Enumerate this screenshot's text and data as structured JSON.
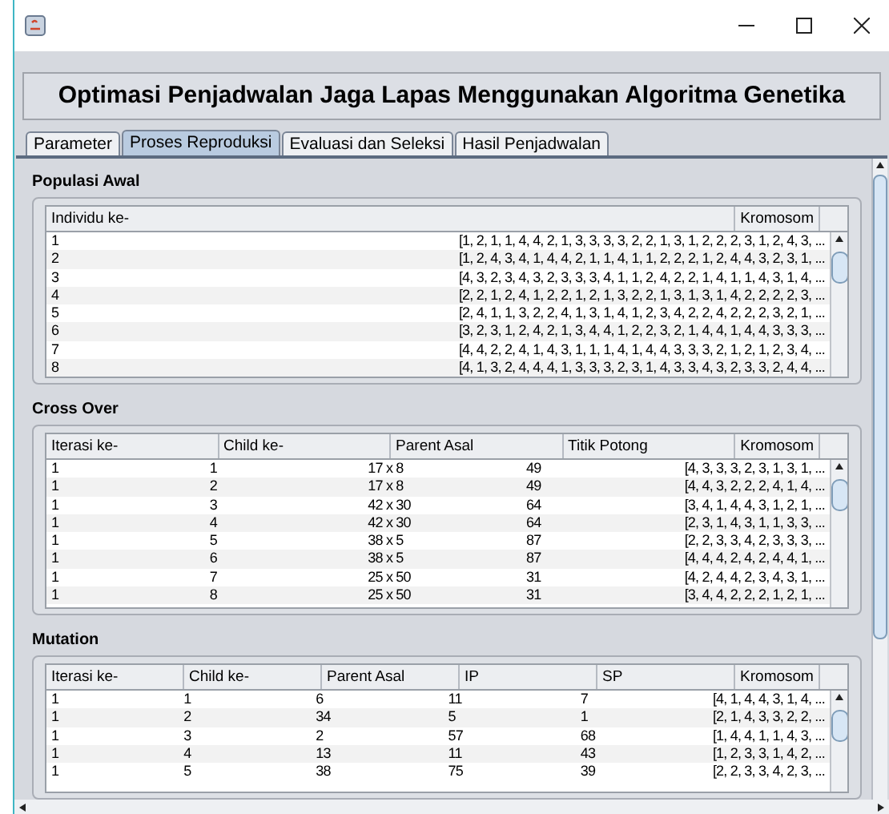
{
  "header": "Optimasi Penjadwalan Jaga Lapas Menggunakan Algoritma Genetika",
  "tabs": [
    {
      "label": "Parameter",
      "selected": false
    },
    {
      "label": "Proses Reproduksi",
      "selected": true
    },
    {
      "label": "Evaluasi dan Seleksi",
      "selected": false
    },
    {
      "label": "Hasil Penjadwalan",
      "selected": false
    }
  ],
  "sections": [
    {
      "title": "Populasi Awal",
      "columns": [
        "Individu ke-",
        "Kromosom"
      ],
      "rows": [
        [
          "1",
          "[1, 2, 1, 1, 4, 4, 2, 1, 3, 3, 3, 3, 2, 2, 1, 3, 1, 2, 2, 2, 3, 1, 2, 4, 3, ..."
        ],
        [
          "2",
          "[1, 2, 4, 3, 4, 1, 4, 4, 2, 1, 1, 4, 1, 1, 2, 2, 2, 1, 2, 4, 4, 3, 2, 3, 1, ..."
        ],
        [
          "3",
          "[4, 3, 2, 3, 4, 3, 2, 3, 3, 3, 4, 1, 1, 2, 4, 2, 2, 1, 4, 1, 1, 4, 3, 1, 4, ..."
        ],
        [
          "4",
          "[2, 2, 1, 2, 4, 1, 2, 2, 1, 2, 1, 3, 2, 2, 1, 3, 1, 3, 1, 4, 2, 2, 2, 2, 3, ..."
        ],
        [
          "5",
          "[2, 4, 1, 1, 3, 2, 2, 4, 1, 3, 1, 4, 1, 2, 3, 4, 2, 2, 4, 2, 2, 2, 3, 2, 1, ..."
        ],
        [
          "6",
          "[3, 2, 3, 1, 2, 4, 2, 1, 3, 4, 4, 1, 2, 2, 3, 2, 1, 4, 4, 1, 4, 4, 3, 3, 3, ..."
        ],
        [
          "7",
          "[4, 4, 2, 2, 4, 1, 4, 3, 1, 1, 1, 4, 1, 4, 4, 3, 3, 3, 2, 1, 2, 1, 2, 3, 4, ..."
        ],
        [
          "8",
          "[4, 1, 3, 2, 4, 4, 4, 1, 3, 3, 3, 2, 3, 1, 4, 3, 3, 4, 3, 2, 3, 3, 2, 4, 4, ..."
        ]
      ]
    },
    {
      "title": "Cross Over",
      "columns": [
        "Iterasi ke-",
        "Child ke-",
        "Parent Asal",
        "Titik Potong",
        "Kromosom"
      ],
      "rows": [
        [
          "1",
          "1",
          "17 x 8",
          "49",
          "[4, 3, 3, 3, 2, 3, 1, 3, 1, ..."
        ],
        [
          "1",
          "2",
          "17 x 8",
          "49",
          "[4, 4, 3, 2, 2, 2, 4, 1, 4, ..."
        ],
        [
          "1",
          "3",
          "42 x 30",
          "64",
          "[3, 4, 1, 4, 4, 3, 1, 2, 1, ..."
        ],
        [
          "1",
          "4",
          "42 x 30",
          "64",
          "[2, 3, 1, 4, 3, 1, 1, 3, 3, ..."
        ],
        [
          "1",
          "5",
          "38 x 5",
          "87",
          "[2, 2, 3, 3, 4, 2, 3, 3, 3, ..."
        ],
        [
          "1",
          "6",
          "38 x 5",
          "87",
          "[4, 4, 4, 2, 4, 2, 4, 4, 1, ..."
        ],
        [
          "1",
          "7",
          "25 x 50",
          "31",
          "[4, 2, 4, 4, 2, 3, 4, 3, 1, ..."
        ],
        [
          "1",
          "8",
          "25 x 50",
          "31",
          "[3, 4, 4, 2, 2, 2, 1, 2, 1, ..."
        ]
      ]
    },
    {
      "title": "Mutation",
      "columns": [
        "Iterasi ke-",
        "Child ke-",
        "Parent Asal",
        "IP",
        "SP",
        "Kromosom"
      ],
      "rows": [
        [
          "1",
          "1",
          "6",
          "11",
          "7",
          "[4, 1, 4, 4, 3, 1, 4, ..."
        ],
        [
          "1",
          "2",
          "34",
          "5",
          "1",
          "[2, 1, 4, 3, 3, 2, 2, ..."
        ],
        [
          "1",
          "3",
          "2",
          "57",
          "68",
          "[1, 4, 4, 1, 1, 4, 3, ..."
        ],
        [
          "1",
          "4",
          "13",
          "11",
          "43",
          "[1, 2, 3, 3, 1, 4, 2, ..."
        ],
        [
          "1",
          "5",
          "38",
          "75",
          "39",
          "[2, 2, 3, 3, 4, 2, 3, ..."
        ]
      ]
    }
  ]
}
